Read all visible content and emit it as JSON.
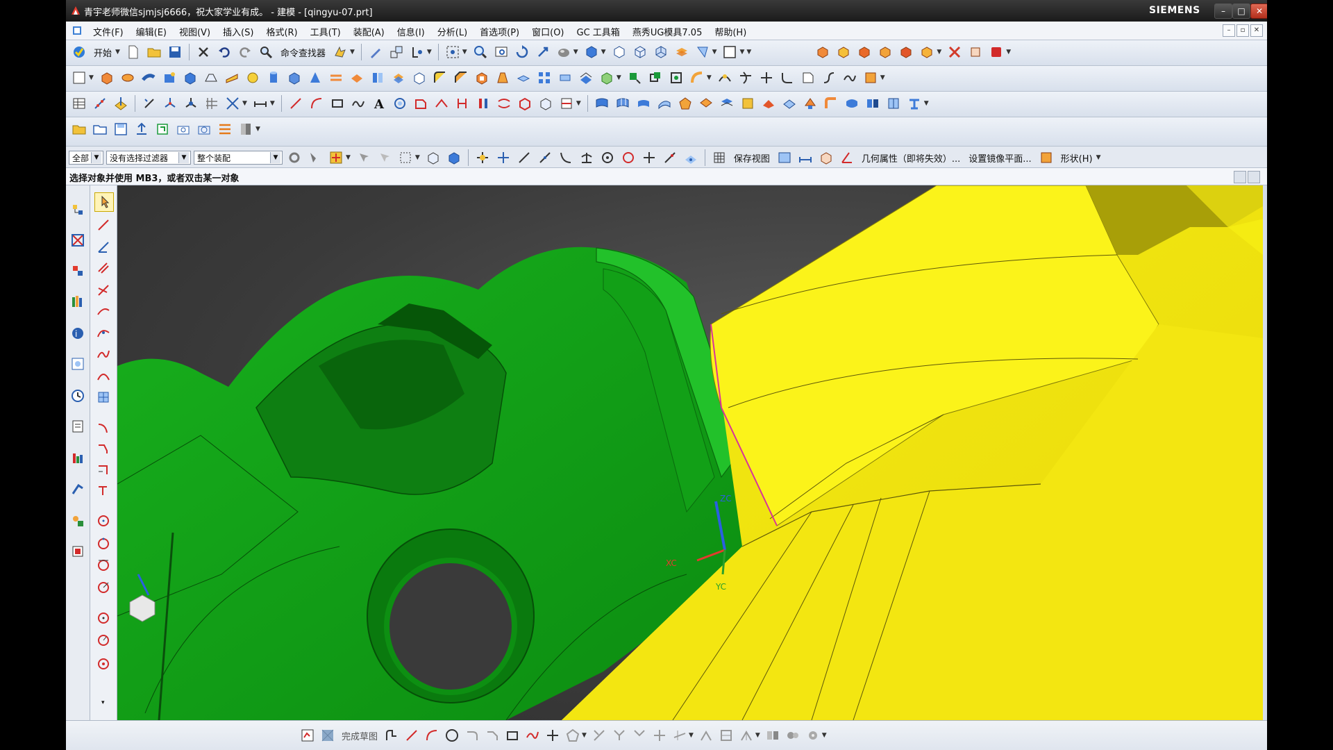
{
  "window": {
    "title": "青宇老师微信sjmjsj6666，祝大家学业有成。 - 建模 - [qingyu-07.prt]",
    "brand": "SIEMENS",
    "minimize": "–",
    "maximize": "□",
    "close": "✕"
  },
  "menu": {
    "items": [
      "文件(F)",
      "编辑(E)",
      "视图(V)",
      "插入(S)",
      "格式(R)",
      "工具(T)",
      "装配(A)",
      "信息(I)",
      "分析(L)",
      "首选项(P)",
      "窗口(O)",
      "GC 工具箱",
      "燕秀UG模具7.05",
      "帮助(H)"
    ],
    "mdi": [
      "–",
      "▫",
      "✕"
    ]
  },
  "toolbar1": {
    "start_label": "开始",
    "command_finder_label": "命令查找器"
  },
  "selection_bar": {
    "filter_scope": "全部",
    "filter_type": "没有选择过滤器",
    "assembly_scope": "整个装配",
    "save_view_label": "保存视图",
    "geometry_props_label": "几何属性（即将失效）...",
    "mirror_plane_label": "设置镜像平面...",
    "shape_label": "形状(H)"
  },
  "cue_line": {
    "text": "选择对象并使用 MB3，或者双击某一对象"
  },
  "sketch_bar": {
    "finish_label": "完成草图"
  },
  "viewport": {
    "axis_x": "XC",
    "axis_y": "YC",
    "axis_z": "ZC"
  },
  "colors": {
    "green_body": "#13a51a",
    "yellow_body": "#f5ec12",
    "viewport_bg": "#3c3c3c"
  }
}
